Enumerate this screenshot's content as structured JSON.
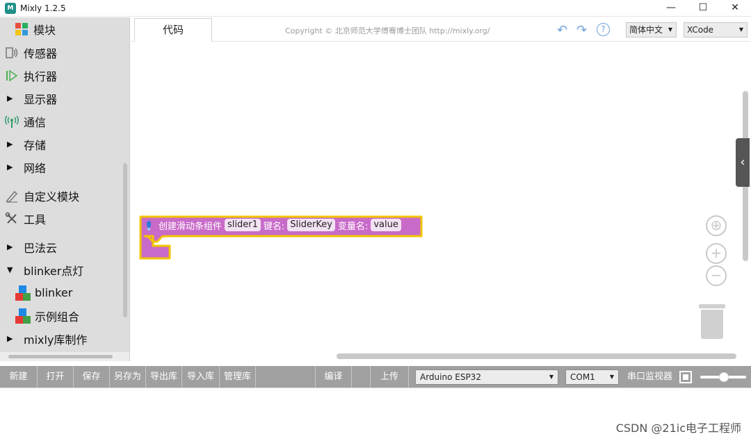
{
  "window": {
    "title": "Mixly 1.2.5",
    "controls": [
      "—",
      "☐",
      "✕"
    ]
  },
  "sidebar": {
    "header": "模块",
    "items": [
      {
        "label": "传感器",
        "type": "icon",
        "icon": "sensor-icon"
      },
      {
        "label": "执行器",
        "type": "icon",
        "icon": "actuator-icon"
      },
      {
        "label": "显示器",
        "type": "toggle"
      },
      {
        "label": "通信",
        "type": "icon",
        "icon": "antenna-icon"
      },
      {
        "label": "存储",
        "type": "toggle"
      },
      {
        "label": "网络",
        "type": "toggle"
      },
      {
        "label": "自定义模块",
        "type": "icon",
        "icon": "pen-icon"
      },
      {
        "label": "工具",
        "type": "icon",
        "icon": "tools-icon"
      },
      {
        "label": "巴法云",
        "type": "toggle"
      },
      {
        "label": "blinker点灯",
        "type": "toggle-open"
      },
      {
        "label": "blinker",
        "type": "sub"
      },
      {
        "label": "示例组合",
        "type": "sub"
      },
      {
        "label": "mixly库制作",
        "type": "toggle"
      }
    ]
  },
  "header": {
    "tab": "代码",
    "copyright": "Copyright © 北京师范大学傅骞博士团队 http://mixly.org/",
    "undo": "↶",
    "redo": "↷",
    "help": "?",
    "language": "简体中文",
    "theme": "XCode"
  },
  "workspace": {
    "block": {
      "label": "创建滑动条组件",
      "name_value": "slider1",
      "key_label": "键名:",
      "key_value": "SliderKey",
      "var_label": "变量名:",
      "var_value": "value"
    },
    "controls": {
      "center": "⊕",
      "zoom_in": "+",
      "zoom_out": "−",
      "collapse": "‹"
    }
  },
  "toolbar": {
    "new": "新建",
    "open": "打开",
    "save": "保存",
    "save_as": "另存为",
    "export_lib": "导出库",
    "import_lib": "导入库",
    "manage_lib": "管理库",
    "compile": "编译",
    "upload": "上传",
    "board": "Arduino ESP32",
    "port": "COM1",
    "serial_monitor": "串口监视器"
  },
  "watermark": "CSDN @21ic电子工程师",
  "colors": {
    "block_fill": "#c86bc8",
    "block_border": "#f2c400",
    "sidebar_bg": "#dddddd",
    "toolbar_bg": "#a0a0a0",
    "accent": "#6ea0d8"
  }
}
